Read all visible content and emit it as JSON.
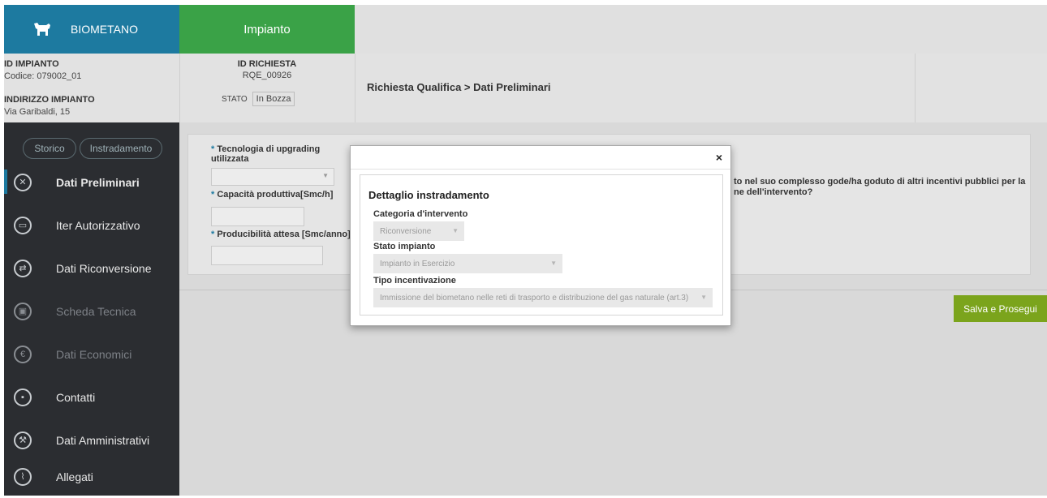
{
  "header": {
    "brand": "BIOMETANO",
    "tab": "Impianto"
  },
  "info": {
    "id_impianto_label": "ID IMPIANTO",
    "codice": "Codice: 079002_01",
    "indirizzo_label": "INDIRIZZO IMPIANTO",
    "indirizzo": "Via Garibaldi, 15",
    "id_richiesta_label": "ID RICHIESTA",
    "id_richiesta": "RQE_00926",
    "stato_label": "STATO",
    "stato_value": "In Bozza",
    "breadcrumb": "Richiesta Qualifica > Dati Preliminari"
  },
  "sidebar": {
    "pills": [
      "Storico",
      "Instradamento"
    ],
    "items": [
      {
        "label": "Dati Preliminari",
        "icon": "tools-icon"
      },
      {
        "label": "Iter Autorizzativo",
        "icon": "calendar-icon"
      },
      {
        "label": "Dati Riconversione",
        "icon": "shuffle-icon"
      },
      {
        "label": "Scheda Tecnica",
        "icon": "wallet-icon"
      },
      {
        "label": "Dati Economici",
        "icon": "euro-icon"
      },
      {
        "label": "Contatti",
        "icon": "contact-icon"
      },
      {
        "label": "Dati Amministrativi",
        "icon": "wrench-icon"
      },
      {
        "label": "Allegati",
        "icon": "paperclip-icon"
      }
    ]
  },
  "form": {
    "req": "*",
    "tecnologia_label": "Tecnologia di upgrading utilizzata",
    "capacita_label": "Capacità produttiva[Smc/h]",
    "producibilita_label": "Producibilità attesa [Smc/anno]",
    "incentivi_q_line1": "to nel suo complesso gode/ha goduto di altri incentivi pubblici per la",
    "incentivi_q_line2": "ne dell'intervento?"
  },
  "actions": {
    "save": "Salva e Prosegui"
  },
  "modal": {
    "close": "×",
    "title": "Dettaglio instradamento",
    "categoria_label": "Categoria d'intervento",
    "categoria_value": "Riconversione",
    "stato_label": "Stato impianto",
    "stato_value": "Impianto in Esercizio",
    "tipo_label": "Tipo incentivazione",
    "tipo_value": "Immissione del biometano nelle reti di trasporto e distribuzione del gas naturale (art.3)",
    "caret": "▼"
  }
}
